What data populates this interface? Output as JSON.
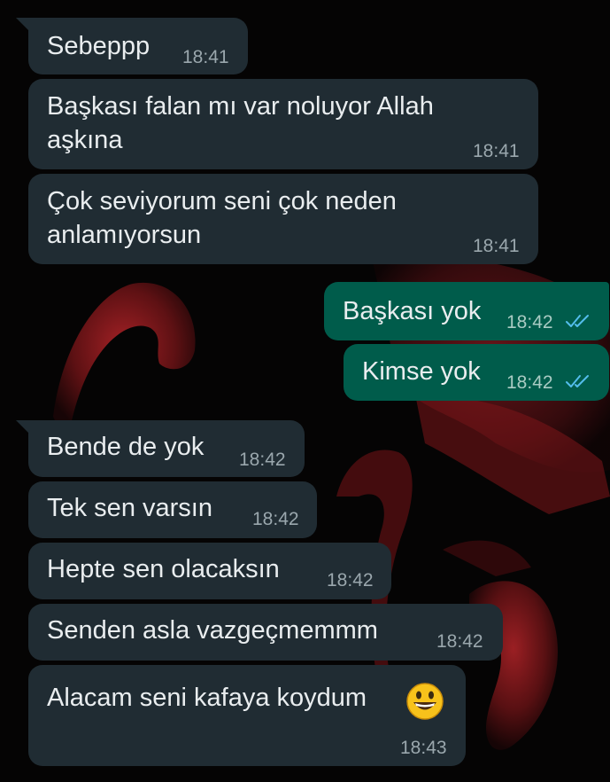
{
  "messages": [
    {
      "direction": "incoming",
      "text": "Sebeppp",
      "time": "18:41"
    },
    {
      "direction": "incoming",
      "text_lines": [
        "Başkası falan mı var noluyor Allah",
        "aşkına"
      ],
      "time": "18:41"
    },
    {
      "direction": "incoming",
      "text_lines": [
        "Çok seviyorum seni çok neden",
        "anlamıyorsun"
      ],
      "time": "18:41"
    },
    {
      "direction": "outgoing",
      "text": "Başkası yok",
      "time": "18:42",
      "status": "read"
    },
    {
      "direction": "outgoing",
      "text": "Kimse yok",
      "time": "18:42",
      "status": "read"
    },
    {
      "direction": "incoming",
      "text": "Bende de yok",
      "time": "18:42"
    },
    {
      "direction": "incoming",
      "text": "Tek sen varsın",
      "time": "18:42"
    },
    {
      "direction": "incoming",
      "text": "Hepte sen olacaksın",
      "time": "18:42"
    },
    {
      "direction": "incoming",
      "text": "Senden asla vazgeçmemmm",
      "time": "18:42"
    },
    {
      "direction": "incoming",
      "text": "Alacam seni kafaya koydum",
      "emoji": "grinning-face",
      "time": "18:43"
    }
  ],
  "colors": {
    "incoming_bubble": "#202c33",
    "outgoing_bubble": "#005c4b",
    "read_ticks": "#53bdeb",
    "background": "#050404"
  }
}
